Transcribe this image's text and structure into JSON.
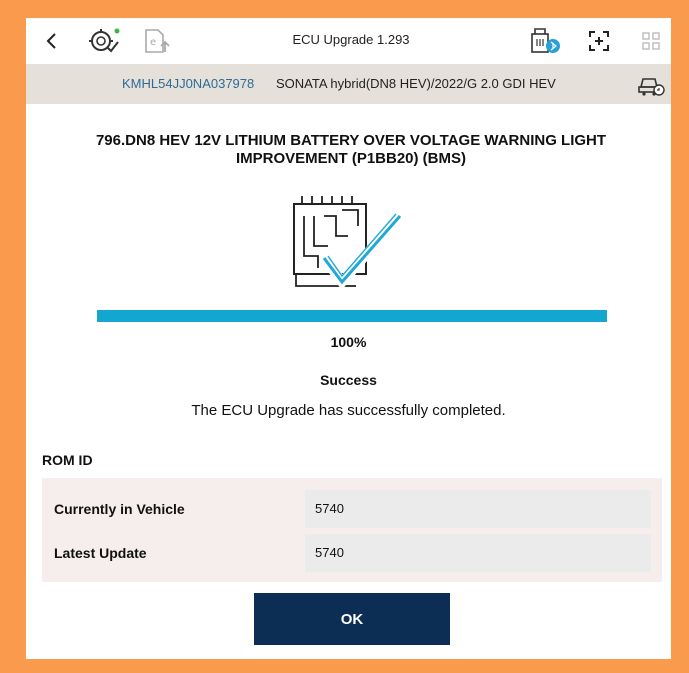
{
  "toolbar": {
    "title": "ECU Upgrade 1.293",
    "icons": [
      "back-chevron-icon",
      "vehicle-diagnosis-icon",
      "e-document-upload-icon",
      "bluetooth-vci-icon",
      "screen-capture-icon",
      "grid-menu-icon"
    ]
  },
  "vehicle": {
    "vin": "KMHL54JJ0NA037978",
    "name": "SONATA hybrid(DN8 HEV)/2022/G 2.0 GDI HEV"
  },
  "upgrade": {
    "title": "796.DN8 HEV 12V LITHIUM BATTERY OVER VOLTAGE WARNING LIGHT IMPROVEMENT (P1BB20) (BMS)",
    "progress_percent": 100,
    "progress_label": "100%",
    "status": "Success",
    "message": "The ECU Upgrade has successfully completed."
  },
  "rom": {
    "heading": "ROM ID",
    "rows": [
      {
        "label": "Currently in Vehicle",
        "value": "5740"
      },
      {
        "label": "Latest Update",
        "value": "5740"
      }
    ]
  },
  "actions": {
    "ok_label": "OK"
  },
  "colors": {
    "frame": "#f99a4c",
    "vehicle_bar": "#e6e0da",
    "vin_link": "#2d6b96",
    "progress": "#13a6cf",
    "ok_button": "#0c2d54",
    "check_accent": "#21a8d6"
  }
}
